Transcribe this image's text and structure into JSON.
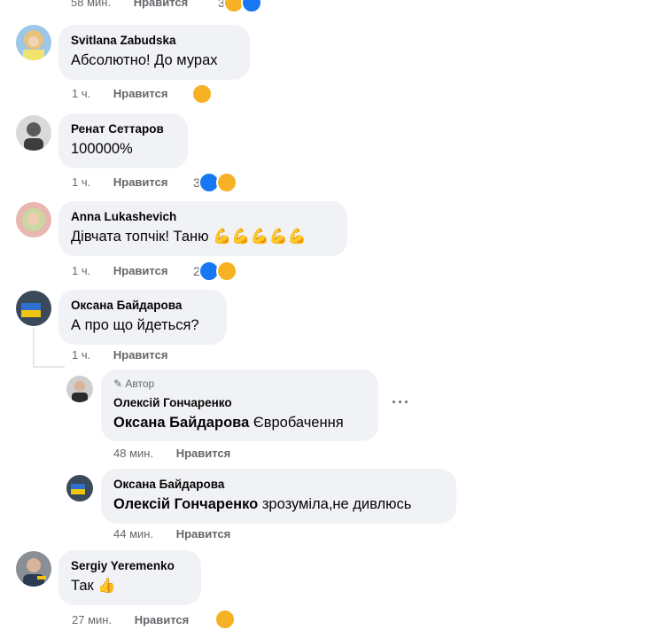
{
  "like_label": "Нравится",
  "author_badge": "Автор",
  "top_meta": {
    "time": "58 мин.",
    "reactions": "3"
  },
  "comments": [
    {
      "author": "Svitlana Zabudska",
      "text": "Абсолютно! До мурах",
      "time": "1 ч.",
      "reactions": ""
    },
    {
      "author": "Ренат Сеттаров",
      "text": "100000%",
      "time": "1 ч.",
      "reactions": "3"
    },
    {
      "author": "Anna Lukashevich",
      "text": "Дівчата топчік! Таню",
      "emoji": "💪💪💪💪💪",
      "time": "1 ч.",
      "reactions": "2"
    },
    {
      "author": "Оксана Байдарова",
      "text": "А про що йдеться?",
      "time": "1 ч."
    },
    {
      "author": "Sergiy Yeremenko",
      "text": "Так",
      "emoji": "👍",
      "time": "27 мин."
    }
  ],
  "replies": [
    {
      "author": "Олексій Гончаренко",
      "mention": "Оксана Байдарова",
      "text": "Євробачення",
      "time": "48 мин."
    },
    {
      "author": "Оксана Байдарова",
      "mention": "Олексій Гончаренко",
      "text": "зрозуміла,не дивлюсь",
      "time": "44 мин."
    }
  ],
  "colors": {
    "like_blue": "#1877f2",
    "care_yellow": "#f7b125",
    "bubble_bg": "#f0f2f5",
    "meta_gray": "#65676b"
  }
}
